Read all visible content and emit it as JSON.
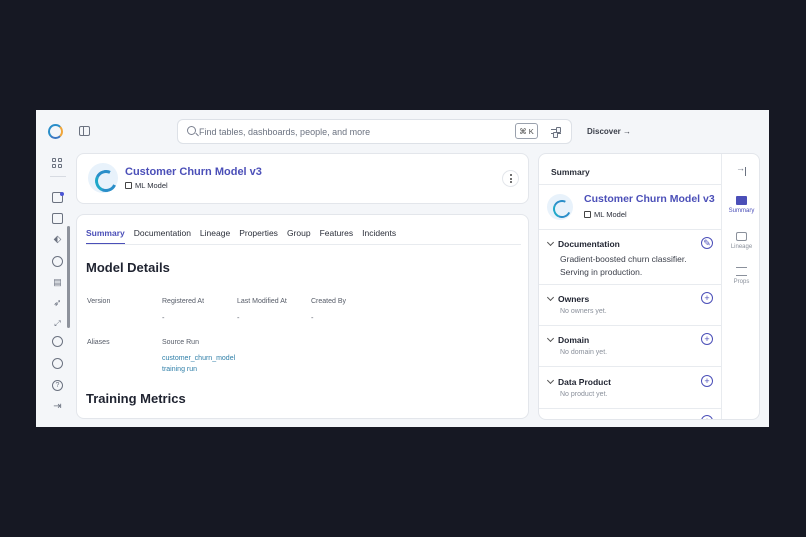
{
  "topbar": {
    "search_placeholder": "Find tables, dashboards, people, and more",
    "shortcut_symbol": "⌘",
    "shortcut_key": "K",
    "discover_label": "Discover",
    "discover_arrow": "→"
  },
  "entity": {
    "title": "Customer Churn Model v3",
    "type": "ML Model"
  },
  "tabs": [
    "Summary",
    "Documentation",
    "Lineage",
    "Properties",
    "Group",
    "Features",
    "Incidents"
  ],
  "details": {
    "heading": "Model Details",
    "fields": [
      {
        "label": "Version",
        "value": ""
      },
      {
        "label": "Registered At",
        "value": "-"
      },
      {
        "label": "Last Modified At",
        "value": "-"
      },
      {
        "label": "Created By",
        "value": "-"
      }
    ],
    "aliases_label": "Aliases",
    "source_run_label": "Source Run",
    "source_run_line1": "customer_churn_model",
    "source_run_line2": "training run",
    "metrics_heading": "Training Metrics"
  },
  "sidebar": {
    "heading": "Summary",
    "title": "Customer Churn Model v3",
    "type": "ML Model",
    "sections": [
      {
        "title": "Documentation",
        "body": "Gradient-boosted churn classifier. Serving in production.",
        "action": "edit"
      },
      {
        "title": "Owners",
        "empty": "No owners yet.",
        "action": "add"
      },
      {
        "title": "Domain",
        "empty": "No domain yet.",
        "action": "add"
      },
      {
        "title": "Data Product",
        "empty": "No product yet.",
        "action": "add"
      }
    ],
    "rail": [
      "Summary",
      "Lineage",
      "Props"
    ]
  },
  "colors": {
    "accent": "#4b4fb8",
    "link": "#2f7fa8",
    "backdrop": "#161823"
  }
}
